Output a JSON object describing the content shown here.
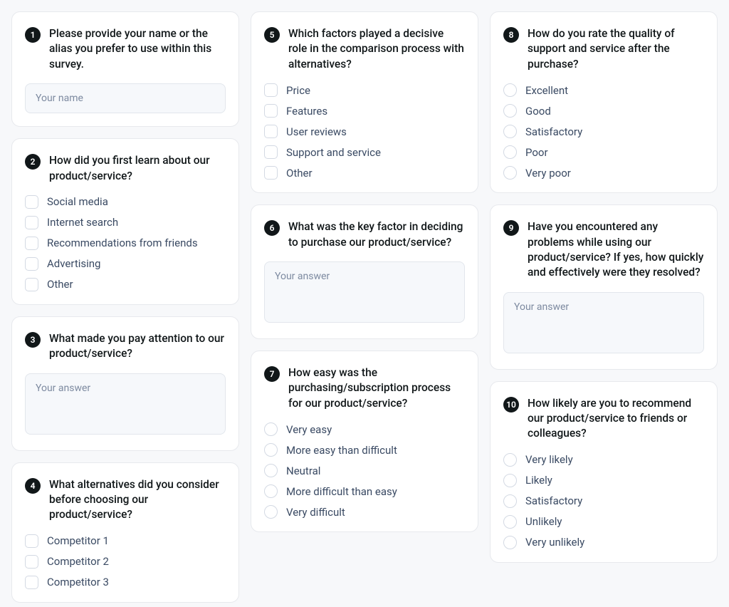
{
  "questions": [
    {
      "number": "1",
      "title": "Please provide your name or the alias you prefer to use within this survey.",
      "type": "text",
      "placeholder": "Your name"
    },
    {
      "number": "2",
      "title": "How did you first learn about our product/service?",
      "type": "checkbox",
      "options": [
        "Social media",
        "Internet search",
        "Recommendations from friends",
        "Advertising",
        "Other"
      ]
    },
    {
      "number": "3",
      "title": "What made you pay attention to our product/service?",
      "type": "textarea",
      "placeholder": "Your answer"
    },
    {
      "number": "4",
      "title": "What alternatives did you consider before choosing our product/service?",
      "type": "checkbox",
      "options": [
        "Competitor 1",
        "Competitor 2",
        "Competitor 3"
      ]
    },
    {
      "number": "5",
      "title": "Which factors played a decisive role in the comparison process with alternatives?",
      "type": "checkbox",
      "options": [
        "Price",
        "Features",
        "User reviews",
        "Support and service",
        "Other"
      ]
    },
    {
      "number": "6",
      "title": "What was the key factor in deciding to purchase our product/service?",
      "type": "textarea",
      "placeholder": "Your answer"
    },
    {
      "number": "7",
      "title": "How easy was the purchasing/subscription process for our product/service?",
      "type": "radio",
      "options": [
        "Very easy",
        "More easy than difficult",
        "Neutral",
        "More difficult than easy",
        "Very difficult"
      ]
    },
    {
      "number": "8",
      "title": "How do you rate the quality of support and service after the purchase?",
      "type": "radio",
      "options": [
        "Excellent",
        "Good",
        "Satisfactory",
        "Poor",
        "Very poor"
      ]
    },
    {
      "number": "9",
      "title": "Have you encountered any problems while using our product/service? If yes, how quickly and effectively were they resolved?",
      "type": "textarea",
      "placeholder": "Your answer"
    },
    {
      "number": "10",
      "title": "How likely are you to recommend our product/service to friends or colleagues?",
      "type": "radio",
      "options": [
        "Very likely",
        "Likely",
        "Satisfactory",
        "Unlikely",
        "Very unlikely"
      ]
    }
  ],
  "layout": {
    "col1": [
      0,
      1,
      2,
      3
    ],
    "col2": [
      4,
      5,
      6
    ],
    "col3": [
      7,
      8,
      9
    ]
  }
}
